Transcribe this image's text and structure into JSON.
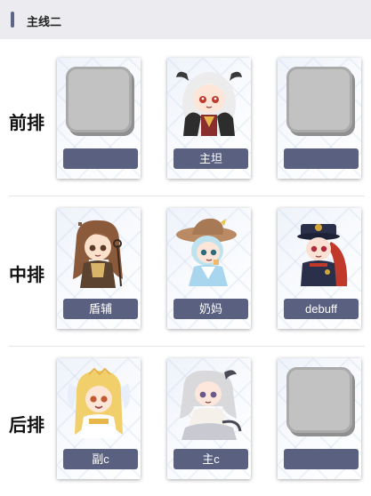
{
  "header": {
    "title": "主线二"
  },
  "rows": [
    {
      "label": "前排",
      "cards": [
        {
          "name": "",
          "portrait": "empty-slot"
        },
        {
          "name": "主坦",
          "portrait": "white-hair-horned-girl"
        },
        {
          "name": "",
          "portrait": "empty-slot"
        }
      ]
    },
    {
      "label": "中排",
      "cards": [
        {
          "name": "盾辅",
          "portrait": "brown-hair-staff-girl"
        },
        {
          "name": "奶妈",
          "portrait": "witch-hat-girl"
        },
        {
          "name": "debuff",
          "portrait": "officer-cap-red-hair-girl"
        }
      ]
    },
    {
      "label": "后排",
      "cards": [
        {
          "name": "副c",
          "portrait": "blonde-winged-girl"
        },
        {
          "name": "主c",
          "portrait": "silver-hair-girl"
        },
        {
          "name": "",
          "portrait": "empty-slot"
        }
      ]
    }
  ],
  "colors": {
    "accent": "#5a6080",
    "header_bg": "#ececf0"
  }
}
